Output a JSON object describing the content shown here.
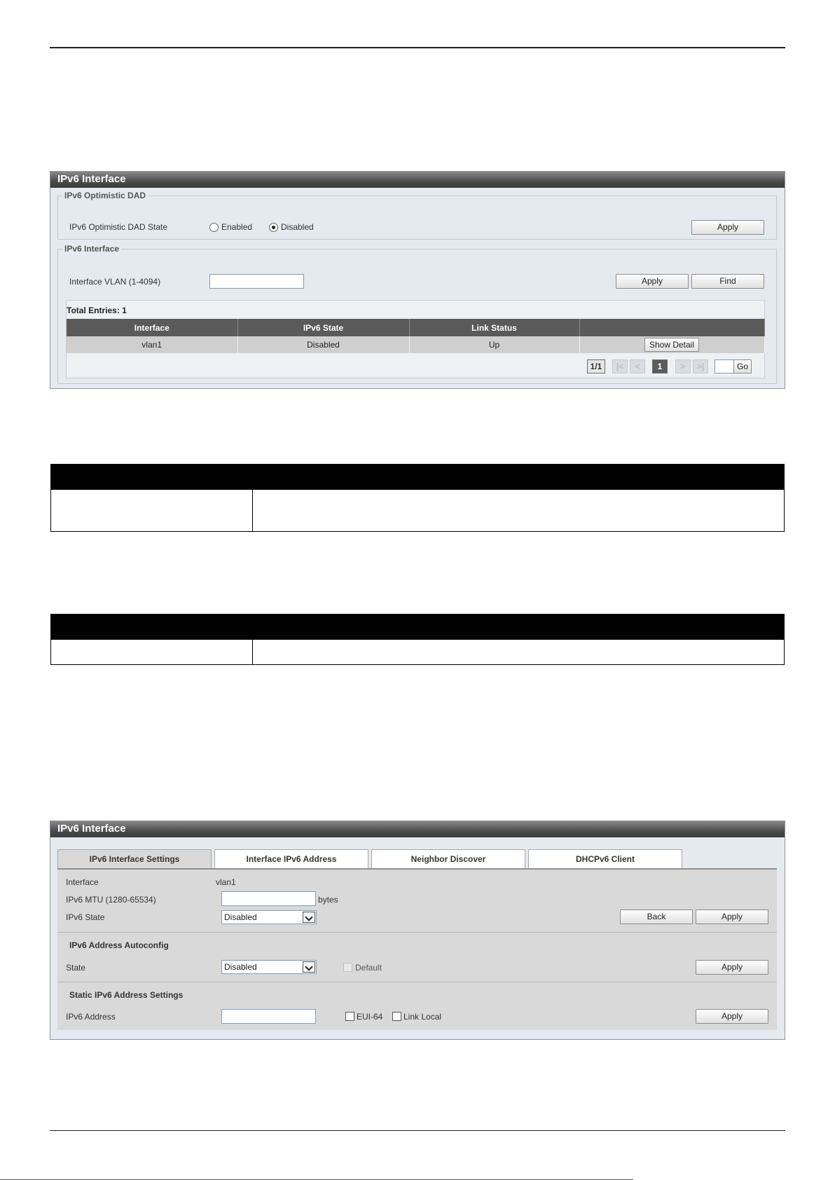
{
  "panel1": {
    "title": "IPv6 Interface",
    "dad_group": {
      "legend": "IPv6 Optimistic DAD",
      "state_label": "IPv6 Optimistic DAD State",
      "enabled_label": "Enabled",
      "disabled_label": "Disabled",
      "selected": "Disabled",
      "apply_label": "Apply"
    },
    "iface_group": {
      "legend": "IPv6 Interface",
      "vlan_label": "Interface VLAN (1-4094)",
      "vlan_value": "",
      "apply_label": "Apply",
      "find_label": "Find",
      "total_entries": "Total Entries: 1",
      "columns": [
        "Interface",
        "IPv6 State",
        "Link Status",
        ""
      ],
      "rows": [
        {
          "interface": "vlan1",
          "state": "Disabled",
          "link": "Up",
          "action": "Show Detail"
        }
      ],
      "pager": {
        "info": "1/1",
        "first": "|<",
        "prev": "<",
        "current": "1",
        "next": ">",
        "last": ">|",
        "goto_value": "",
        "go_label": "Go"
      }
    }
  },
  "panel2": {
    "title": "IPv6 Interface",
    "tabs": [
      "IPv6 Interface Settings",
      "Interface IPv6 Address",
      "Neighbor Discover",
      "DHCPv6 Client"
    ],
    "active_tab": "IPv6 Interface Settings",
    "settings": {
      "interface_label": "Interface",
      "interface_value": "vlan1",
      "mtu_label": "IPv6 MTU (1280-65534)",
      "mtu_value": "",
      "mtu_unit": "bytes",
      "state_label": "IPv6 State",
      "state_value": "Disabled",
      "back_label": "Back",
      "apply_label": "Apply"
    },
    "autoconfig": {
      "heading": "IPv6 Address Autoconfig",
      "state_label": "State",
      "state_value": "Disabled",
      "default_label": "Default",
      "apply_label": "Apply"
    },
    "static": {
      "heading": "Static IPv6 Address Settings",
      "address_label": "IPv6 Address",
      "address_value": "",
      "eui64_label": "EUI-64",
      "linklocal_label": "Link Local",
      "apply_label": "Apply"
    }
  }
}
